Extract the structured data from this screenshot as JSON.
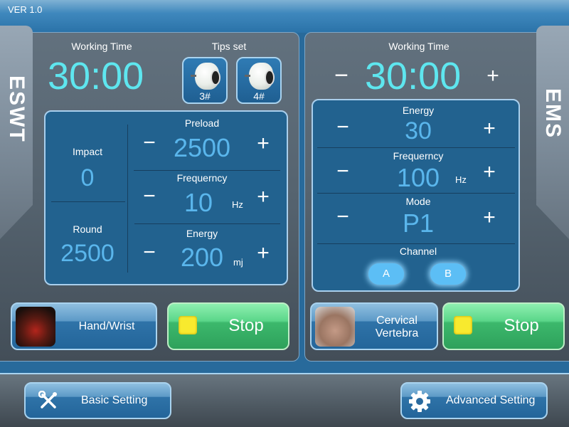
{
  "header": {
    "version": "VER 1.0"
  },
  "eswt": {
    "tab_label": "ESWT",
    "working_time_label": "Working Time",
    "working_time": "30:00",
    "tips_label": "Tips set",
    "tips": [
      {
        "label": "3#",
        "selected": false
      },
      {
        "label": "4#",
        "selected": false
      }
    ],
    "impact_label": "Impact",
    "impact": "0",
    "round_label": "Round",
    "round": "2500",
    "preload_label": "Preload",
    "preload": "2500",
    "frequency_label": "Frequerncy",
    "frequency": "10",
    "frequency_unit": "Hz",
    "energy_label": "Energy",
    "energy": "200",
    "energy_unit": "mj",
    "minus": "−",
    "plus": "+",
    "body_part": "Hand/Wrist",
    "stop_label": "Stop"
  },
  "ems": {
    "tab_label": "EMS",
    "working_time_label": "Working Time",
    "working_time": "30:00",
    "energy_label": "Energy",
    "energy": "30",
    "frequency_label": "Frequerncy",
    "frequency": "100",
    "frequency_unit": "Hz",
    "mode_label": "Mode",
    "mode": "P1",
    "channel_label": "Channel",
    "channels": [
      "A",
      "B"
    ],
    "minus": "−",
    "plus": "+",
    "body_part_line1": "Cervical",
    "body_part_line2": "Vertebra",
    "stop_label": "Stop"
  },
  "footer": {
    "basic_setting": "Basic Setting",
    "advanced_setting": "Advanced Setting"
  },
  "colors": {
    "time_cyan": "#5ee6ef",
    "value_blue": "#5ab6ec",
    "stop_green": "#3cb86c",
    "indicator_yellow": "#f8ea2e"
  }
}
